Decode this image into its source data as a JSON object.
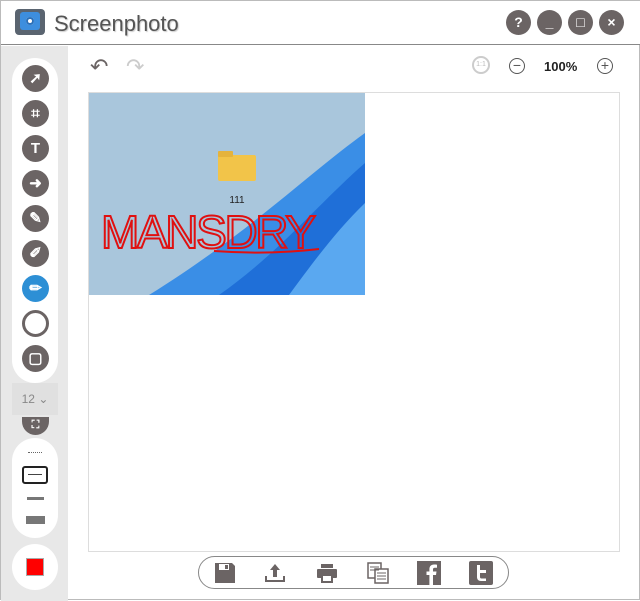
{
  "app": {
    "title": "Screenphoto"
  },
  "window_buttons": {
    "help": "?",
    "minimize": "_",
    "maximize": "□",
    "close": "×"
  },
  "toolbar": {
    "zoom_level": "100%",
    "actual_size_label": "1:1"
  },
  "tools": [
    "arrow",
    "crop",
    "text",
    "arrow-shape",
    "pen",
    "highlighter",
    "pencil",
    "ellipse",
    "rectangle",
    "mosaic"
  ],
  "active_tool": "pencil",
  "font_size": {
    "value": "12"
  },
  "color": {
    "current": "#ff0000"
  },
  "image": {
    "folder_label": "111",
    "annotation": "MANSDRY"
  },
  "bottom_actions": [
    "save",
    "upload",
    "print",
    "copy",
    "facebook",
    "twitter"
  ]
}
